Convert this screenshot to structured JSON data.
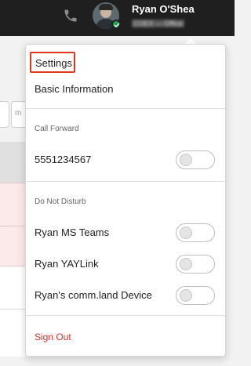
{
  "header": {
    "user_name": "Ryan O'Shea",
    "user_status": "COEX — Office",
    "presence_color": "#1ea34a"
  },
  "background": {
    "input_placeholder": "m"
  },
  "menu": {
    "settings_label": "Settings",
    "basic_info_label": "Basic Information",
    "call_forward": {
      "section_label": "Call Forward",
      "number": "5551234567",
      "enabled": false
    },
    "do_not_disturb": {
      "section_label": "Do Not Disturb",
      "devices": [
        {
          "label": "Ryan MS Teams",
          "enabled": false
        },
        {
          "label": "Ryan YAYLink",
          "enabled": false
        },
        {
          "label": "Ryan's comm.land Device",
          "enabled": false
        }
      ]
    },
    "sign_out_label": "Sign Out",
    "highlight_color": "#e0371f",
    "sign_out_color": "#d93025"
  }
}
